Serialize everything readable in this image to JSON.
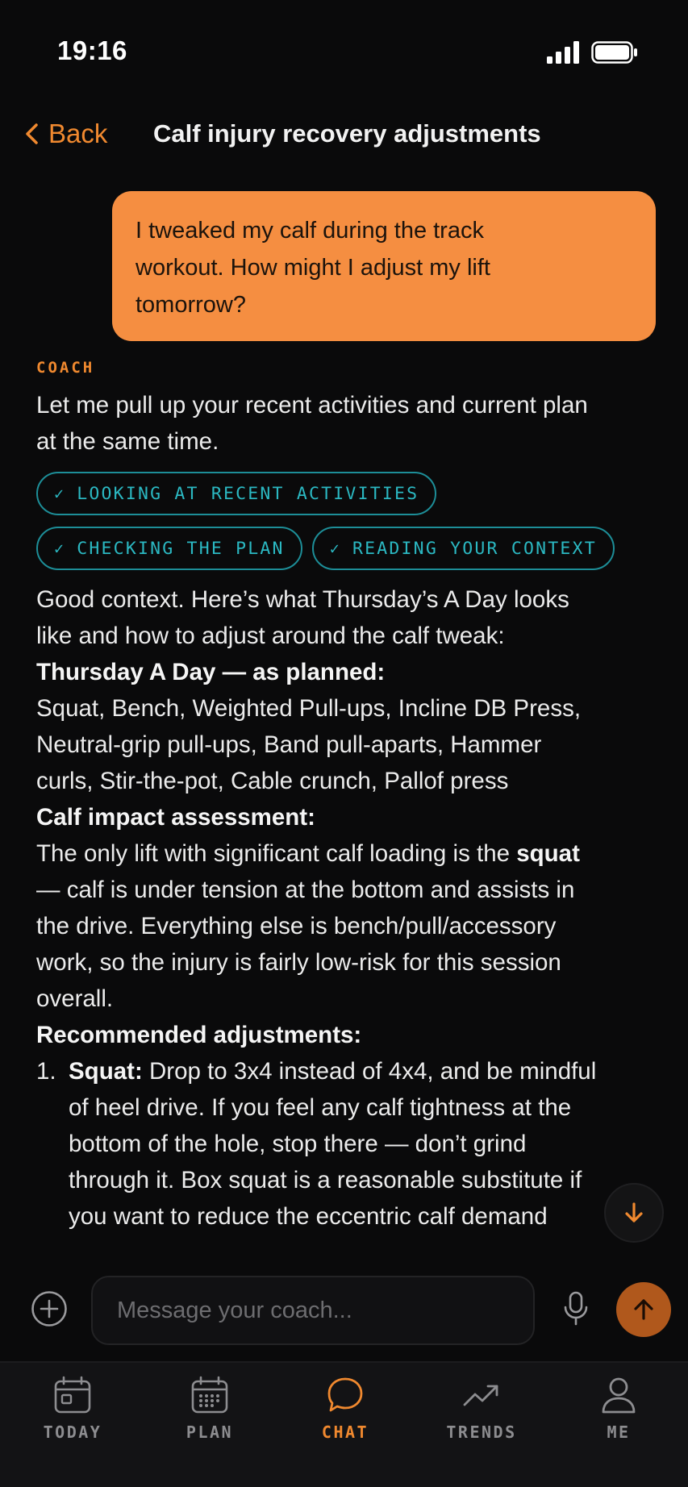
{
  "status_bar": {
    "time": "19:16"
  },
  "header": {
    "back_label": "Back",
    "title": "Calf injury recovery adjustments"
  },
  "user_message": {
    "lines": [
      "I tweaked my calf during the track",
      "workout. How might I adjust my lift",
      "tomorrow?"
    ]
  },
  "coach": {
    "label": "COACH",
    "intro_lines": [
      "Let me pull up your recent activities and current plan",
      "at the same time."
    ],
    "tool_chips": [
      {
        "check": "✓",
        "label": "LOOKING AT RECENT ACTIVITIES"
      },
      {
        "check": "✓",
        "label": "CHECKING THE PLAN"
      },
      {
        "check": "✓",
        "label": "READING YOUR CONTEXT"
      }
    ],
    "context_lines": [
      "Good context. Here’s what Thursday’s A Day looks",
      "like and how to adjust around the calf tweak:"
    ],
    "planned_heading": "Thursday A Day — as planned:",
    "planned_lines": [
      "Squat, Bench, Weighted Pull-ups, Incline DB Press,",
      "Neutral-grip pull-ups, Band pull-aparts, Hammer",
      "curls, Stir-the-pot, Cable crunch, Pallof press"
    ],
    "impact_heading": "Calf impact assessment:",
    "impact": {
      "line1_prefix": "The only lift with significant calf loading is the ",
      "line1_bold": "squat",
      "rest_lines": [
        "— calf is under tension at the bottom and assists in",
        "the drive. Everything else is bench/pull/accessory",
        "work, so the injury is fairly low-risk for this session",
        "overall."
      ]
    },
    "recommend_heading": "Recommended adjustments:",
    "recommendations": [
      {
        "number": "1.",
        "bold": "Squat:",
        "first_line": " Drop to 3x4 instead of 4x4, and be mindful",
        "rest_lines": [
          "of heel drive. If you feel any calf tightness at the",
          "bottom of the hole, stop there — don’t grind",
          "through it. Box squat is a reasonable substitute if",
          "you want to reduce the eccentric calf demand"
        ]
      }
    ]
  },
  "composer": {
    "placeholder": "Message your coach..."
  },
  "tabs": [
    {
      "label": "TODAY",
      "icon": "calendar-today-icon",
      "active": false
    },
    {
      "label": "PLAN",
      "icon": "calendar-grid-icon",
      "active": false
    },
    {
      "label": "CHAT",
      "icon": "chat-bubble-icon",
      "active": true
    },
    {
      "label": "TRENDS",
      "icon": "trend-line-icon",
      "active": false
    },
    {
      "label": "ME",
      "icon": "person-icon",
      "active": false
    }
  ],
  "colors": {
    "accent": "#f0892f",
    "user_bubble": "#f58e41",
    "chip": "#2bb8c2",
    "background": "#0a0a0b"
  }
}
